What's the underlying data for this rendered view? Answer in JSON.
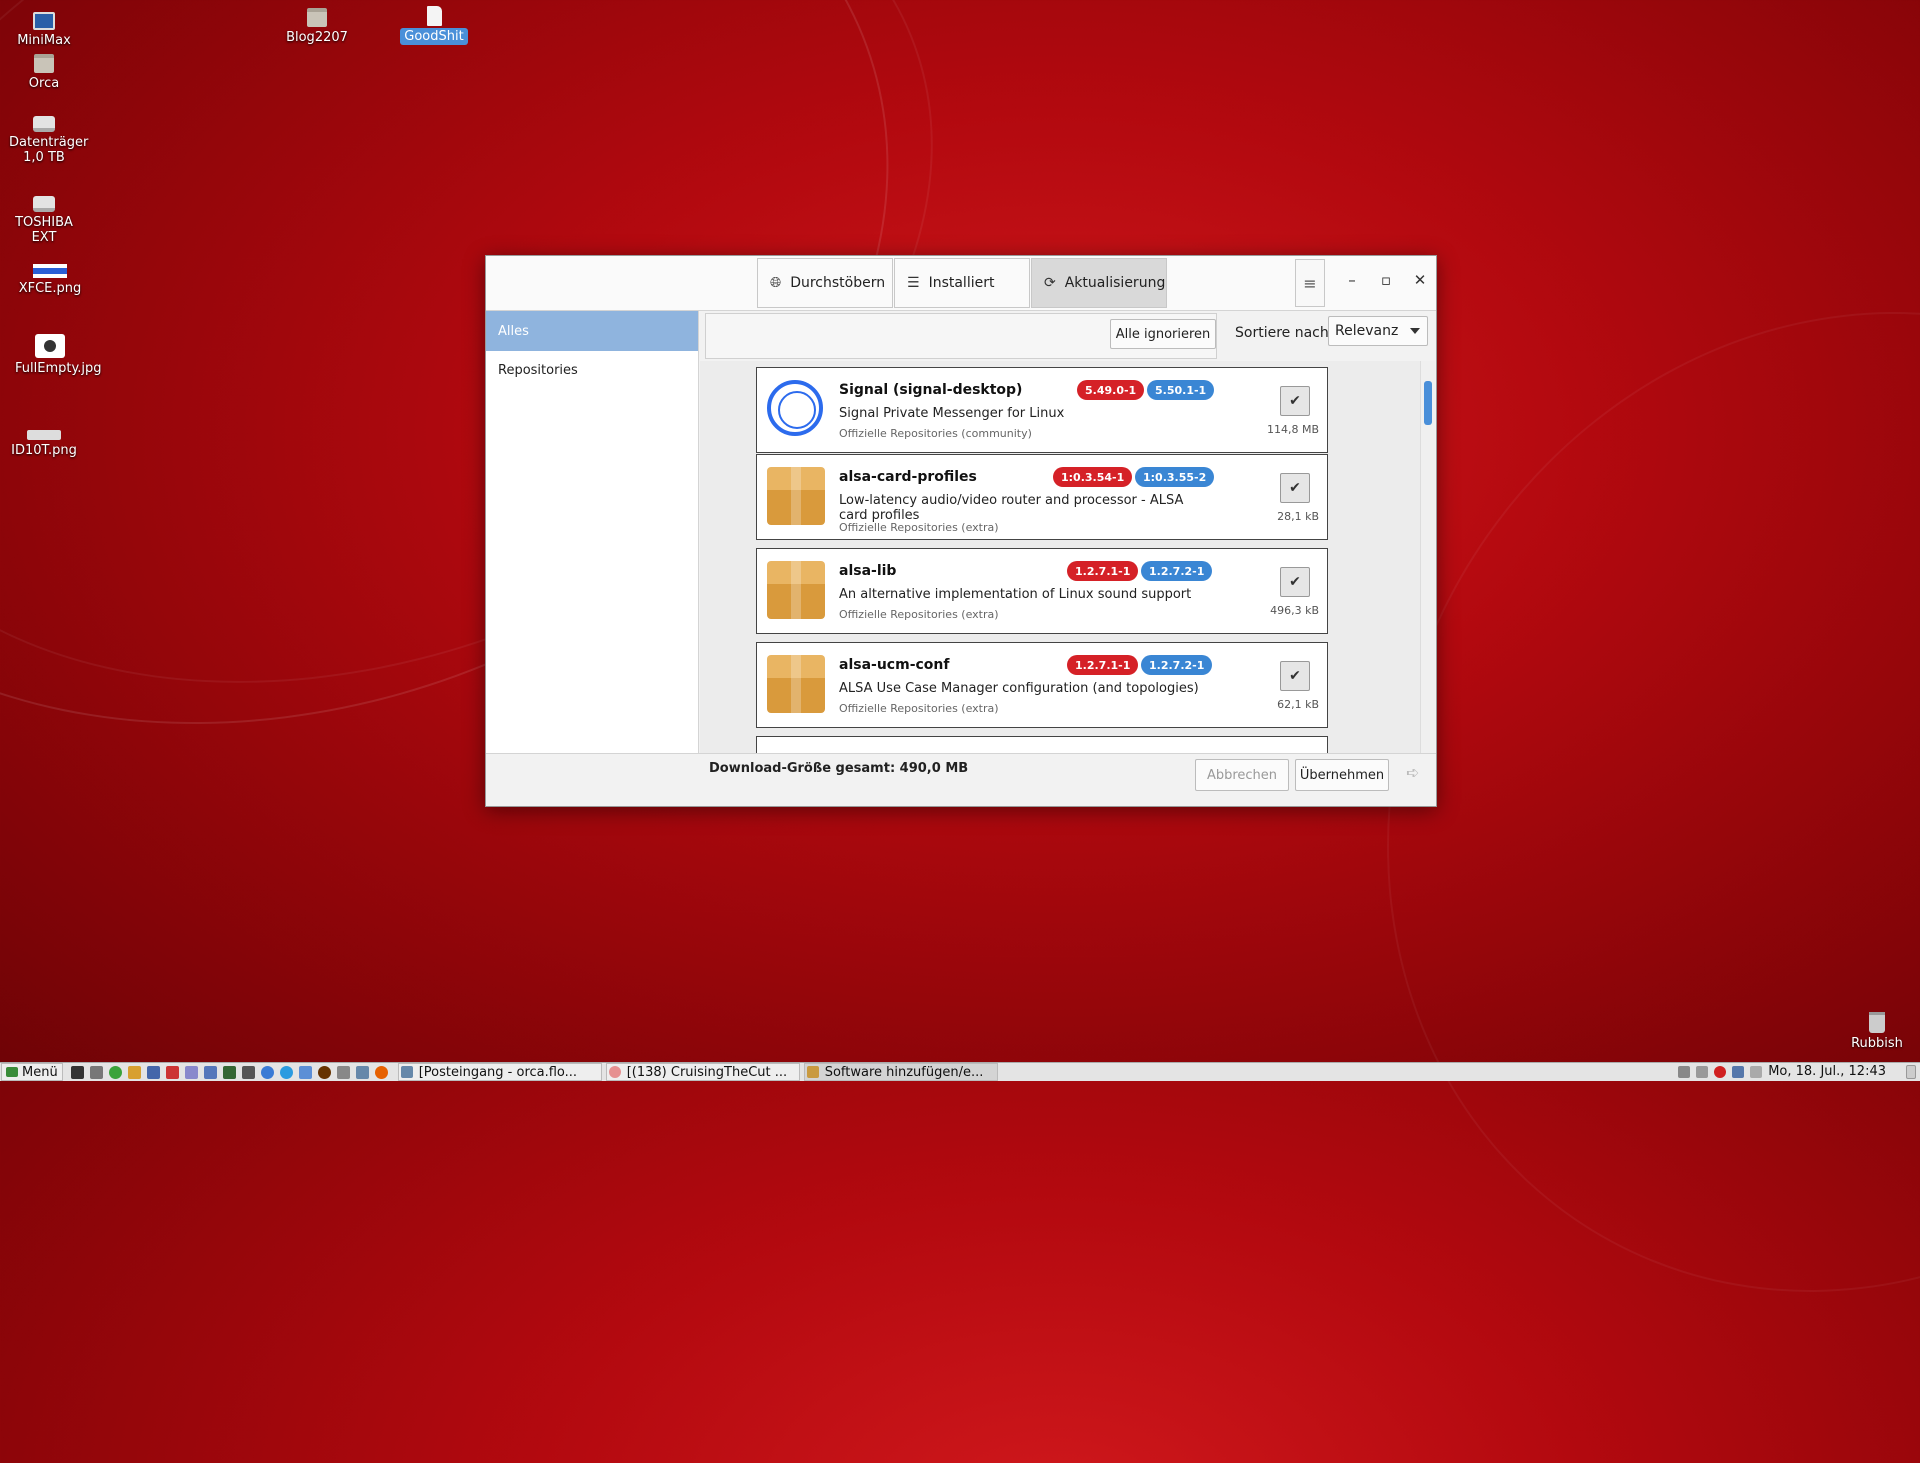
{
  "desktop": {
    "icons": [
      {
        "label": "MiniMax",
        "icon": "computer-icon"
      },
      {
        "label": "Orca",
        "icon": "home-folder-icon"
      },
      {
        "label": "Datenträger 1,0 TB",
        "icon": "drive-icon"
      },
      {
        "label": "TOSHIBA EXT",
        "icon": "drive-icon"
      },
      {
        "label": "XFCE.png",
        "icon": "image-file-icon"
      },
      {
        "label": "FullEmpty.jpg",
        "icon": "image-file-icon"
      },
      {
        "label": "ID10T.png",
        "icon": "image-file-icon"
      },
      {
        "label": "Blog2207",
        "icon": "folder-icon"
      },
      {
        "label": "GoodShit",
        "icon": "document-icon",
        "selected": true
      },
      {
        "label": "Rubbish",
        "icon": "trash-icon"
      }
    ]
  },
  "window": {
    "tabs": [
      {
        "label": "Durchstöbern",
        "icon": "globe-icon"
      },
      {
        "label": "Installiert",
        "icon": "list-icon"
      },
      {
        "label": "Aktualisierungen",
        "icon": "refresh-icon",
        "active": true
      }
    ],
    "controls": {
      "minimize": "–",
      "maximize": "▫",
      "close": "✕"
    },
    "sidebar": [
      {
        "label": "Alles",
        "selected": true
      },
      {
        "label": "Repositories"
      }
    ],
    "toolbar": {
      "ignore_all": "Alle ignorieren",
      "sort_label": "Sortiere nach",
      "sort_value": "Relevanz"
    },
    "packages": [
      {
        "name": "Signal (signal-desktop)",
        "old_version": "5.49.0-1",
        "new_version": "5.50.1-1",
        "description": "Signal Private Messenger for Linux",
        "repo": "Offizielle Repositories (community)",
        "size": "114,8 MB",
        "icon": "signal-icon",
        "checked": true
      },
      {
        "name": "alsa-card-profiles",
        "old_version": "1:0.3.54-1",
        "new_version": "1:0.3.55-2",
        "description": "Low-latency audio/video router and processor - ALSA card profiles",
        "repo": "Offizielle Repositories (extra)",
        "size": "28,1 kB",
        "icon": "package-icon",
        "checked": true
      },
      {
        "name": "alsa-lib",
        "old_version": "1.2.7.1-1",
        "new_version": "1.2.7.2-1",
        "description": "An alternative implementation of Linux sound support",
        "repo": "Offizielle Repositories (extra)",
        "size": "496,3 kB",
        "icon": "package-icon",
        "checked": true
      },
      {
        "name": "alsa-ucm-conf",
        "old_version": "1.2.7.1-1",
        "new_version": "1.2.7.2-1",
        "description": "ALSA Use Case Manager configuration (and topologies)",
        "repo": "Offizielle Repositories (extra)",
        "size": "62,1 kB",
        "icon": "package-icon",
        "checked": true
      }
    ],
    "footer": {
      "download_size": "Download-Größe gesamt: 490,0 MB",
      "cancel": "Abbrechen",
      "apply": "Übernehmen"
    }
  },
  "taskbar": {
    "menu_label": "Menü",
    "tasks": [
      {
        "label": "[Posteingang - orca.flo...",
        "active": false
      },
      {
        "label": "[(138) CruisingTheCut ...",
        "active": false
      },
      {
        "label": "Software hinzufügen/e...",
        "active": true
      }
    ],
    "clock": "Mo, 18. Jul., 12:43"
  }
}
